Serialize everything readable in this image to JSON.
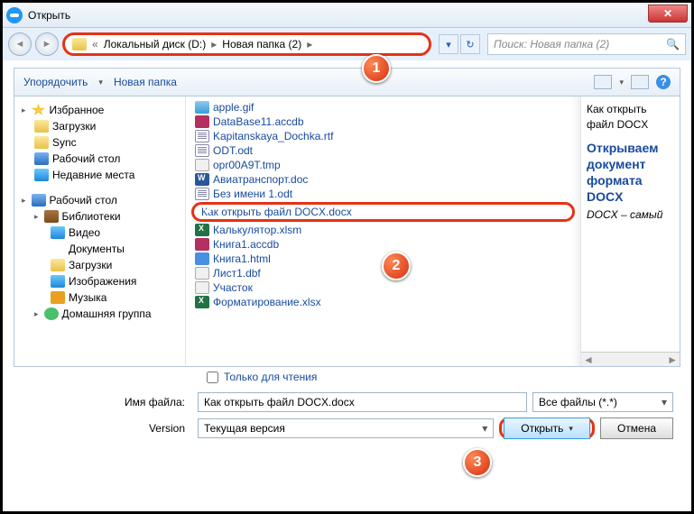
{
  "window": {
    "title": "Открыть",
    "close": "✕"
  },
  "nav": {
    "crumbs": [
      "Локальный диск (D:)",
      "Новая папка (2)"
    ],
    "search_placeholder": "Поиск: Новая папка (2)"
  },
  "toolbar": {
    "organize": "Упорядочить",
    "newfolder": "Новая папка"
  },
  "sidebar": {
    "favorites": "Избранное",
    "fav_items": [
      "Загрузки",
      "Sync",
      "Рабочий стол",
      "Недавние места"
    ],
    "desktop": "Рабочий стол",
    "libraries": "Библиотеки",
    "lib_items": [
      "Видео",
      "Документы",
      "Загрузки",
      "Изображения",
      "Музыка"
    ],
    "homegroup": "Домашняя группа"
  },
  "files": [
    {
      "icon": "image",
      "name": "apple.gif"
    },
    {
      "icon": "db",
      "name": "DataBase11.accdb"
    },
    {
      "icon": "doc",
      "name": "Kapitanskaya_Dochka.rtf"
    },
    {
      "icon": "doc",
      "name": "ODT.odt"
    },
    {
      "icon": "txt",
      "name": "opr00A9T.tmp"
    },
    {
      "icon": "word",
      "name": "Авиатранспорт.doc"
    },
    {
      "icon": "doc",
      "name": "Без имени 1.odt"
    },
    {
      "icon": "word",
      "name": "Как открыть файл DOCX.docx",
      "selected": true
    },
    {
      "icon": "excel",
      "name": "Калькулятор.xlsm"
    },
    {
      "icon": "db",
      "name": "Книга1.accdb"
    },
    {
      "icon": "html",
      "name": "Книга1.html"
    },
    {
      "icon": "txt",
      "name": "Лист1.dbf"
    },
    {
      "icon": "txt",
      "name": "Участок"
    },
    {
      "icon": "excel",
      "name": "Форматирование.xlsx"
    }
  ],
  "readonly_label": "Только для чтения",
  "preview": {
    "name": "Как открыть файл DOCX",
    "title": "Открываем документ формата DOCX",
    "sub": "DOCX – самый"
  },
  "form": {
    "filename_label": "Имя файла:",
    "filename_value": "Как открыть файл DOCX.docx",
    "filter": "Все файлы (*.*)",
    "version_label": "Version",
    "version_value": "Текущая версия",
    "open": "Открыть",
    "cancel": "Отмена"
  },
  "badges": {
    "b1": "1",
    "b2": "2",
    "b3": "3"
  }
}
